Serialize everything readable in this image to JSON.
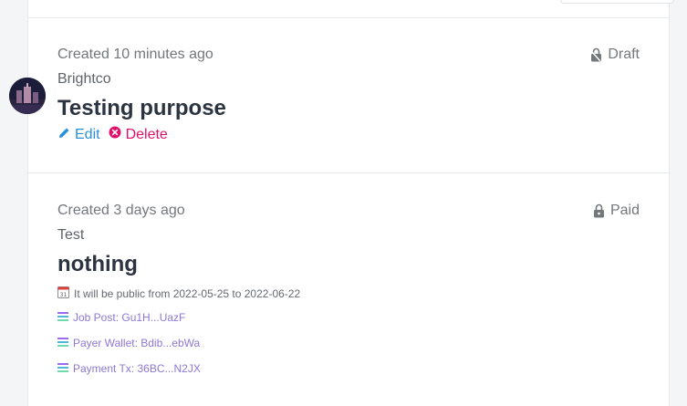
{
  "cards": [
    {
      "created": "Created 10 minutes ago",
      "status": "Draft",
      "status_icon": "draft-lock-icon",
      "org": "Brightco",
      "title": "Testing purpose",
      "edit_label": "Edit",
      "delete_label": "Delete"
    },
    {
      "created": "Created 3 days ago",
      "status": "Paid",
      "status_icon": "lock-icon",
      "org": "Test",
      "title": "nothing",
      "public_period": "It will be public from 2022-05-25 to 2022-06-22",
      "links": {
        "job_post": "Job Post: Gu1H...UazF",
        "payer_wallet": "Payer Wallet: Bdib...ebWa",
        "payment_tx": "Payment Tx: 36BC...N2JX"
      }
    }
  ],
  "colors": {
    "edit": "#2a8fd9",
    "delete": "#e0116b",
    "link": "#8d78d6",
    "title": "#2b3440"
  }
}
